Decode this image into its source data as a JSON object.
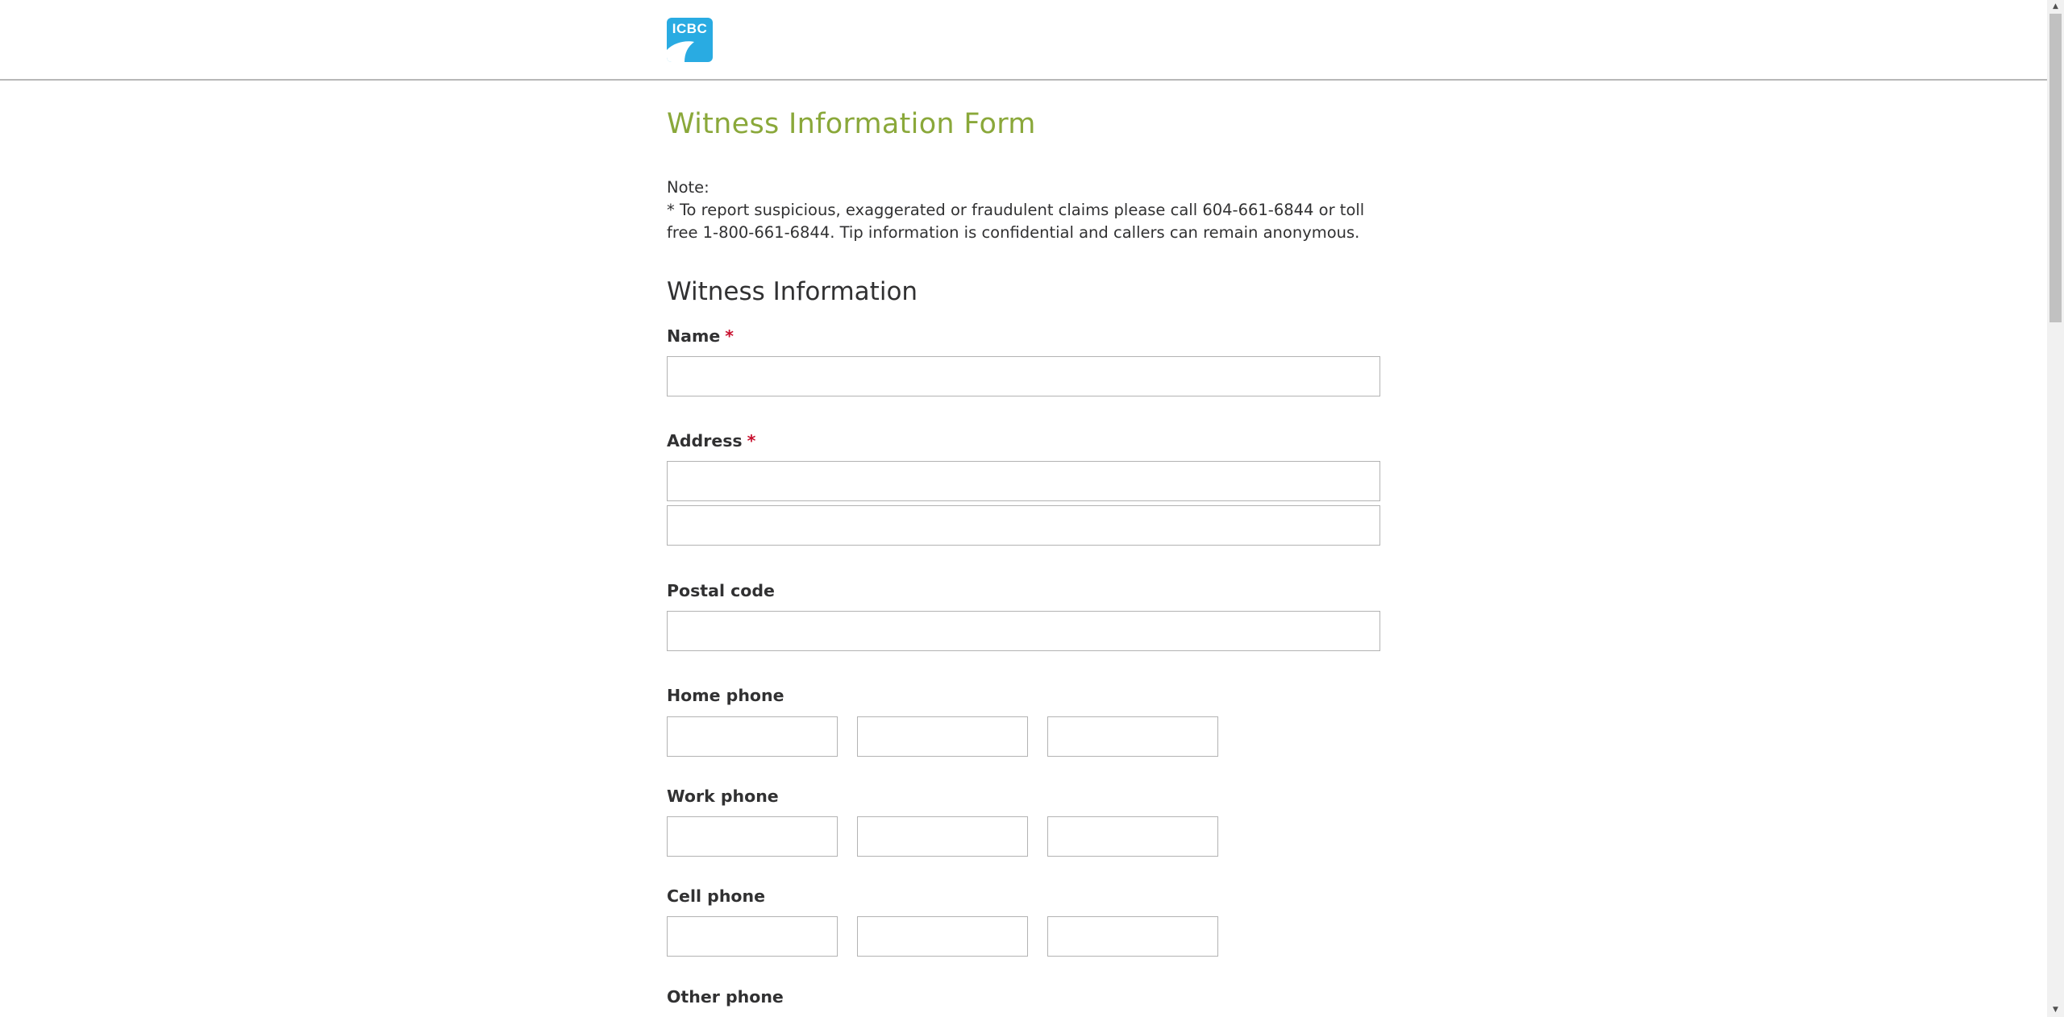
{
  "header": {
    "logo_text": "ICBC",
    "logo_color": "#29abe2"
  },
  "form": {
    "title": "Witness Information Form",
    "note_label": "Note:",
    "note_text": "* To report suspicious, exaggerated or fraudulent claims please call 604-661-6844 or toll free 1-800-661-6844. Tip information is confidential and callers can remain anonymous.",
    "section_title": "Witness Information",
    "required_marker": "*",
    "fields": {
      "name": {
        "label": "Name",
        "value": ""
      },
      "address": {
        "label": "Address",
        "line1": "",
        "line2": ""
      },
      "postal_code": {
        "label": "Postal code",
        "value": ""
      },
      "home_phone": {
        "label": "Home phone",
        "parts": [
          "",
          "",
          ""
        ]
      },
      "work_phone": {
        "label": "Work phone",
        "parts": [
          "",
          "",
          ""
        ]
      },
      "cell_phone": {
        "label": "Cell phone",
        "parts": [
          "",
          "",
          ""
        ]
      },
      "other_phone": {
        "label": "Other phone"
      }
    }
  },
  "colors": {
    "title_green": "#8aa83a",
    "required_red": "#c8102e",
    "text": "#313132",
    "input_border": "#b3b3b3"
  },
  "scrollbar": {
    "up_icon": "arrow-up-icon",
    "down_icon": "arrow-down-icon"
  }
}
